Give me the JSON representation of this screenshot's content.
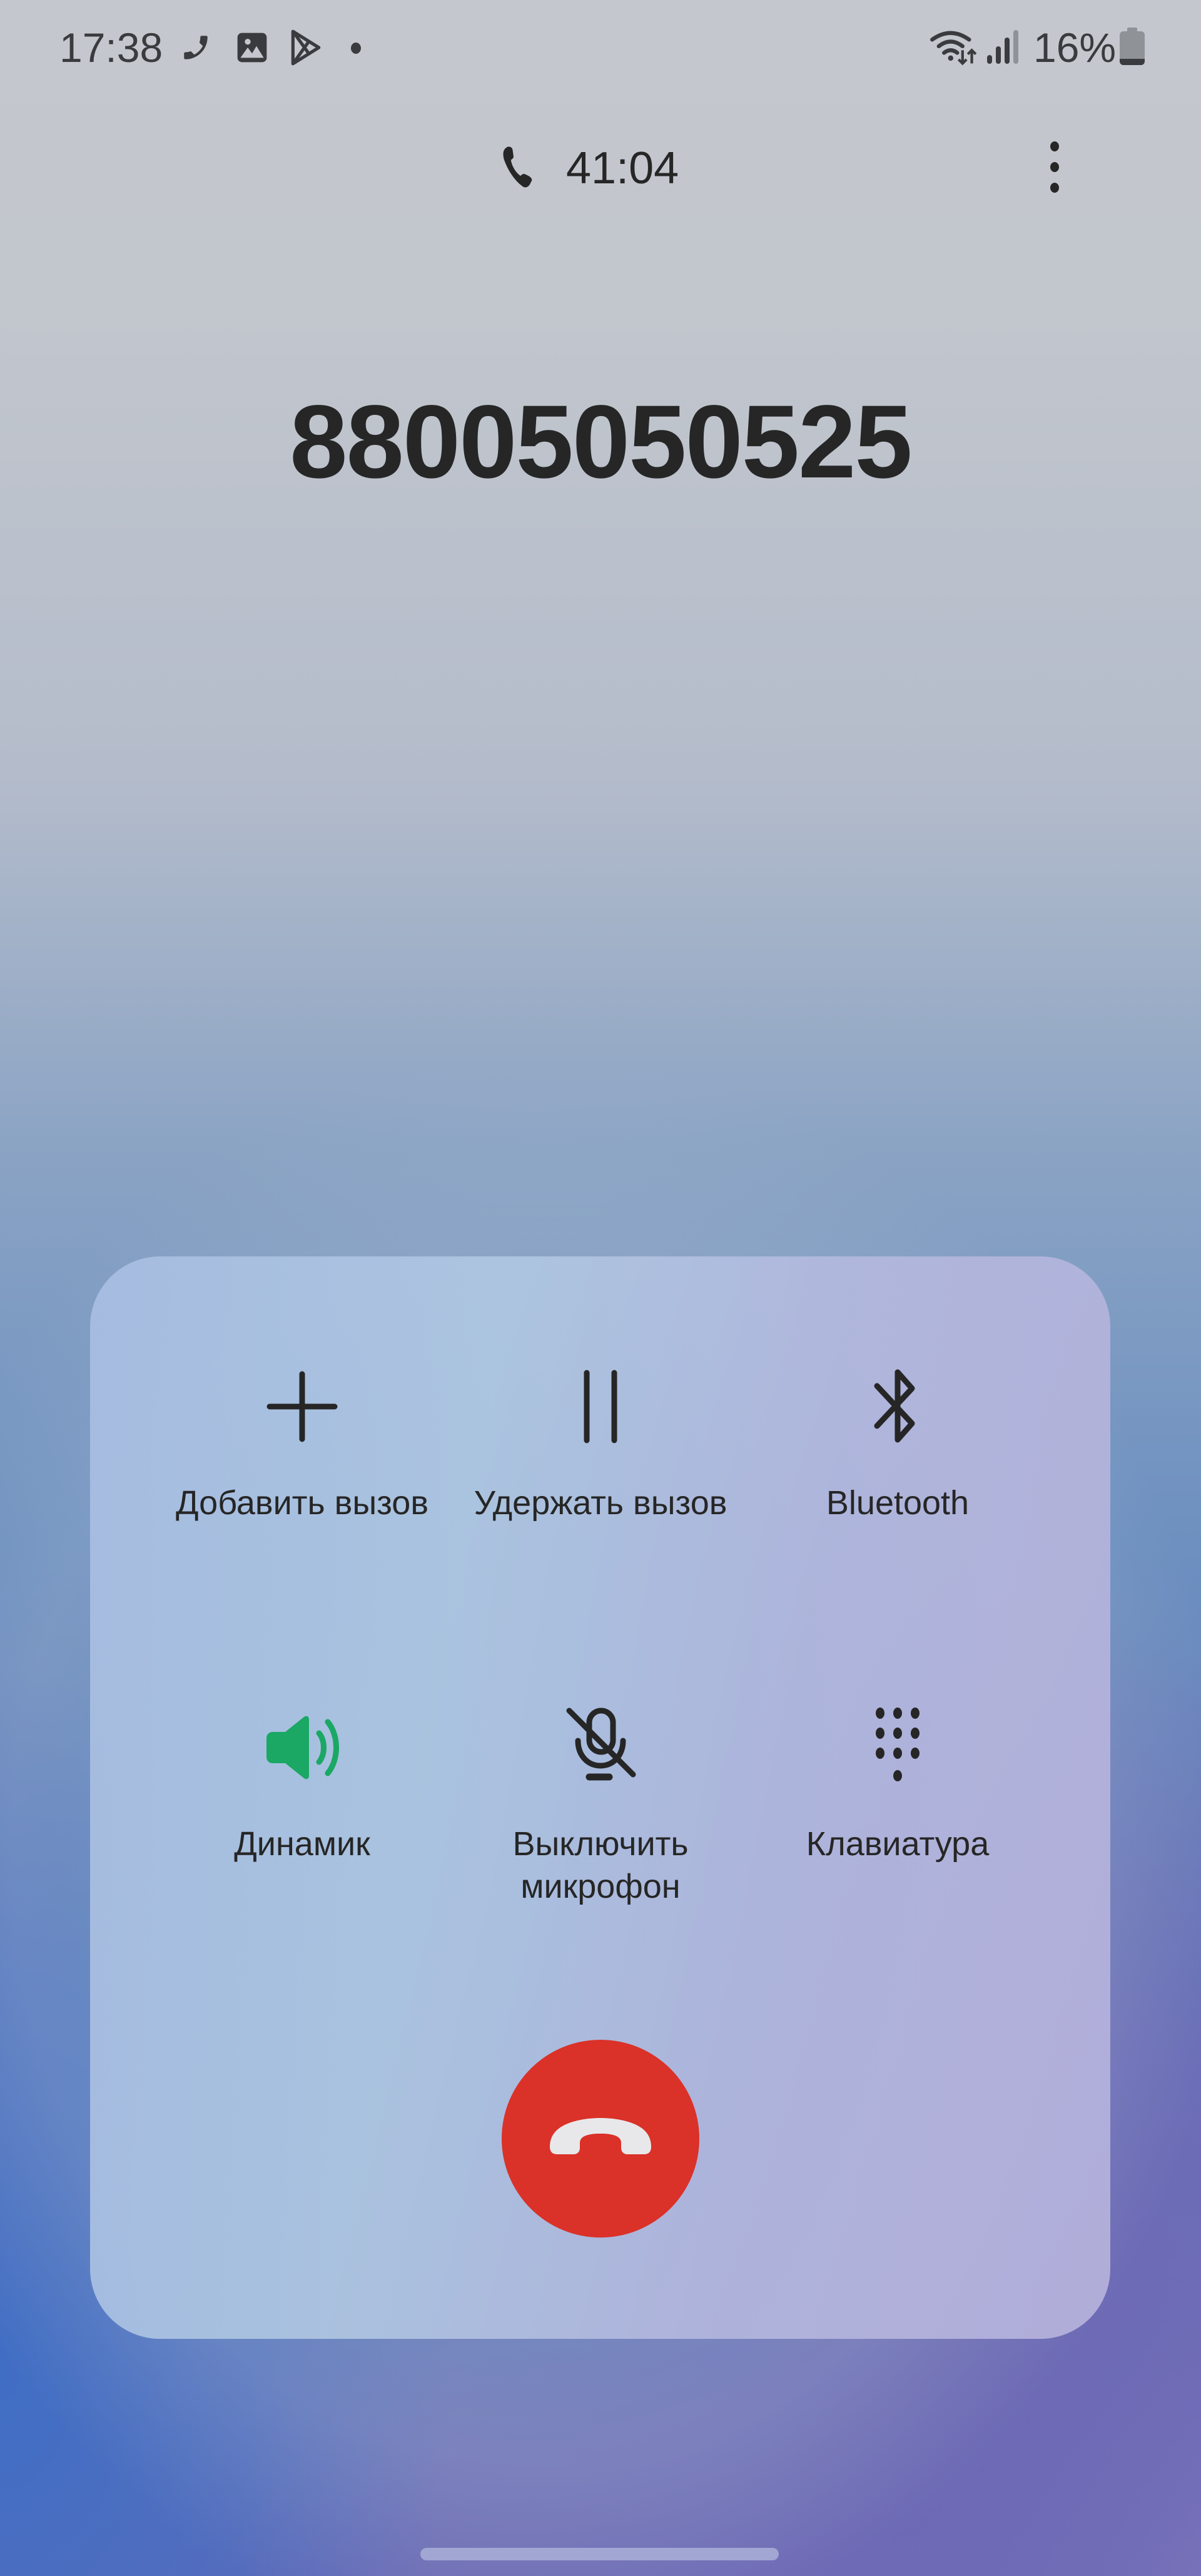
{
  "status_bar": {
    "time": "17:38",
    "left_icons": [
      "phone-call-icon",
      "gallery-icon",
      "play-store-icon",
      "more-notifications-dot"
    ],
    "right_icons": [
      "wifi-icon",
      "signal-icon",
      "battery-icon"
    ],
    "battery_percent": "16%",
    "battery_level": 0.16
  },
  "call": {
    "timer": "41:04",
    "number": "88005050525",
    "more_menu_icon": "kebab-menu-icon"
  },
  "controls": [
    {
      "id": "add-call",
      "label": "Добавить вызов",
      "icon": "plus-icon",
      "active": false
    },
    {
      "id": "hold-call",
      "label": "Удержать вызов",
      "icon": "pause-icon",
      "active": false
    },
    {
      "id": "bluetooth",
      "label": "Bluetooth",
      "icon": "bluetooth-icon",
      "active": false
    },
    {
      "id": "speaker",
      "label": "Динамик",
      "icon": "speaker-icon",
      "active": true
    },
    {
      "id": "mute",
      "label": "Выключить\nмикрофон",
      "icon": "mic-off-icon",
      "active": false
    },
    {
      "id": "keypad",
      "label": "Клавиатура",
      "icon": "keypad-icon",
      "active": false
    }
  ],
  "end_call": {
    "icon": "end-call-icon"
  },
  "colors": {
    "active_green": "#1aa864",
    "end_call_red": "#da3128",
    "text_dark": "#262626"
  }
}
